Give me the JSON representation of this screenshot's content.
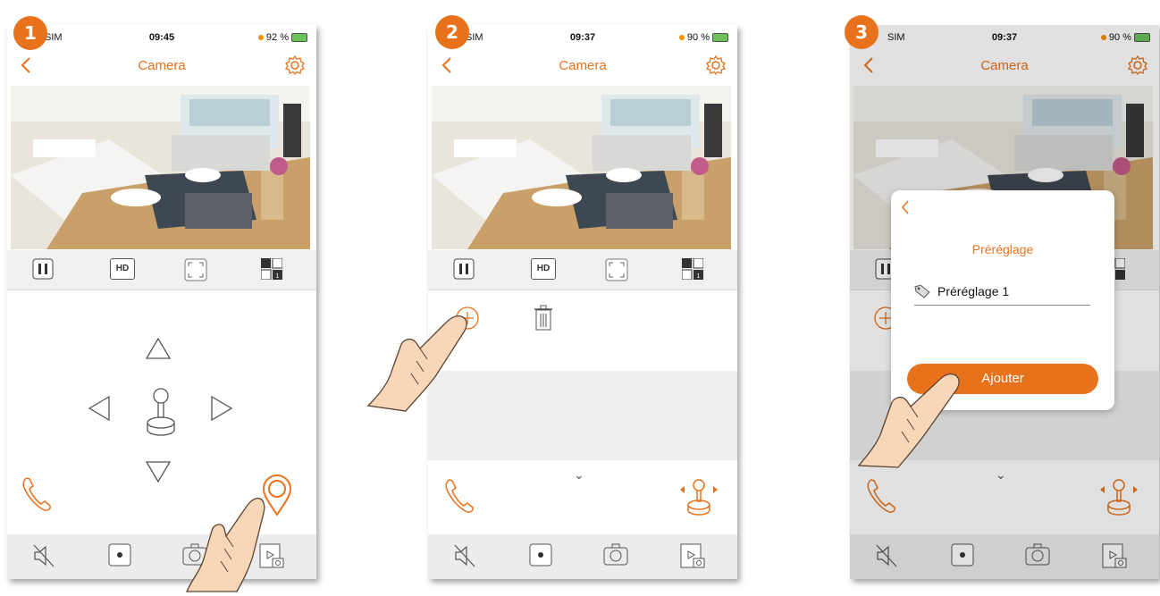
{
  "colors": {
    "accent": "#e8721c",
    "panel": "#f0f0f0",
    "bottombar": "#ececec"
  },
  "steps": [
    {
      "badge": "1",
      "status": {
        "carrier": "SIM",
        "time": "09:45",
        "battery": "92 %"
      },
      "title": "Camera"
    },
    {
      "badge": "2",
      "status": {
        "carrier": "SIM",
        "time": "09:37",
        "battery": "90 %"
      },
      "title": "Camera"
    },
    {
      "badge": "3",
      "status": {
        "carrier": "SIM",
        "time": "09:37",
        "battery": "90 %"
      },
      "title": "Camera"
    }
  ],
  "toolbar": {
    "hd_label": "HD",
    "quad_number": "1"
  },
  "dialog": {
    "title": "Préréglage",
    "preset_value": "Préréglage 1",
    "add_label": "Ajouter"
  },
  "icons": [
    "back-icon",
    "gear-icon",
    "pause-icon",
    "hd-icon",
    "fullscreen-icon",
    "quad-view-icon",
    "arrow-up-icon",
    "arrow-left-icon",
    "arrow-right-icon",
    "arrow-down-icon",
    "joystick-icon",
    "phone-icon",
    "location-pin-icon",
    "add-icon",
    "trash-icon",
    "mute-icon",
    "record-icon",
    "snapshot-icon",
    "gallery-icon",
    "hand-pointer-icon"
  ]
}
